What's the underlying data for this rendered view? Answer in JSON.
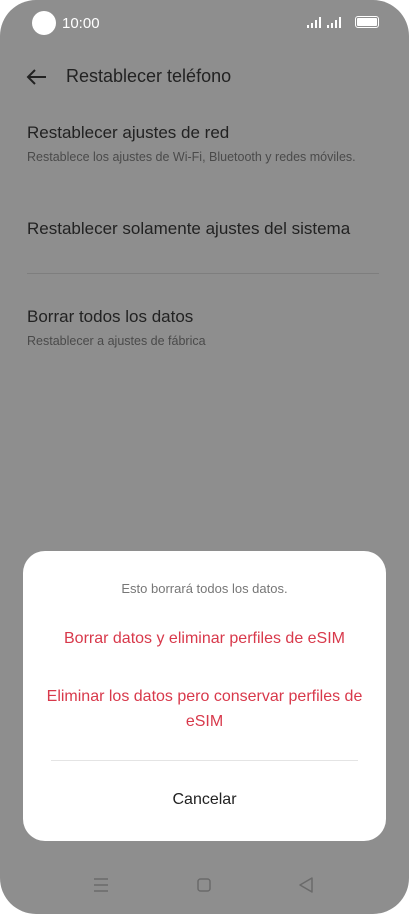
{
  "status_bar": {
    "time": "10:00"
  },
  "header": {
    "title": "Restablecer teléfono"
  },
  "settings": [
    {
      "label": "Restablecer ajustes de red",
      "sublabel": "Restablece los ajustes de Wi-Fi, Bluetooth y redes móviles."
    },
    {
      "label": "Restablecer solamente ajustes del sistema",
      "sublabel": ""
    },
    {
      "label": "Borrar todos los datos",
      "sublabel": "Restablecer a ajustes de fábrica"
    }
  ],
  "dialog": {
    "message": "Esto borrará todos los datos.",
    "option_1": "Borrar datos y eliminar perfiles de eSIM",
    "option_2": "Eliminar los datos pero conservar perfiles de eSIM",
    "cancel": "Cancelar"
  },
  "nav_bar": {
    "icons": [
      "menu-icon",
      "home-icon",
      "back-triangle-icon"
    ]
  },
  "colors": {
    "scrim": "#8e8e8e",
    "accent": "#d8394b"
  }
}
